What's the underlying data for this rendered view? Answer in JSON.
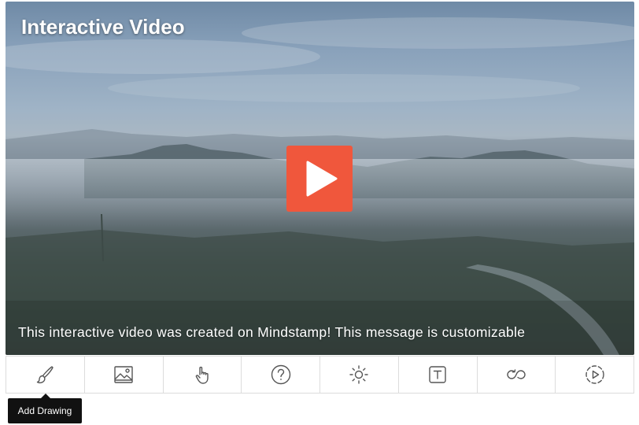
{
  "video": {
    "title": "Interactive Video",
    "caption": "This interactive video was created on Mindstamp! This message is customizable"
  },
  "colors": {
    "play_button": "#f0573c",
    "tooltip_bg": "#111111",
    "toolbar_border": "#dcdcdc",
    "icon_stroke": "#555555"
  },
  "toolbar": {
    "items": [
      {
        "icon": "brush-icon"
      },
      {
        "icon": "image-icon"
      },
      {
        "icon": "hand-pointer-icon"
      },
      {
        "icon": "question-icon"
      },
      {
        "icon": "sun-icon"
      },
      {
        "icon": "text-box-icon"
      },
      {
        "icon": "loop-icon"
      },
      {
        "icon": "dashed-play-icon"
      }
    ]
  },
  "tooltip": {
    "label": "Add Drawing"
  }
}
